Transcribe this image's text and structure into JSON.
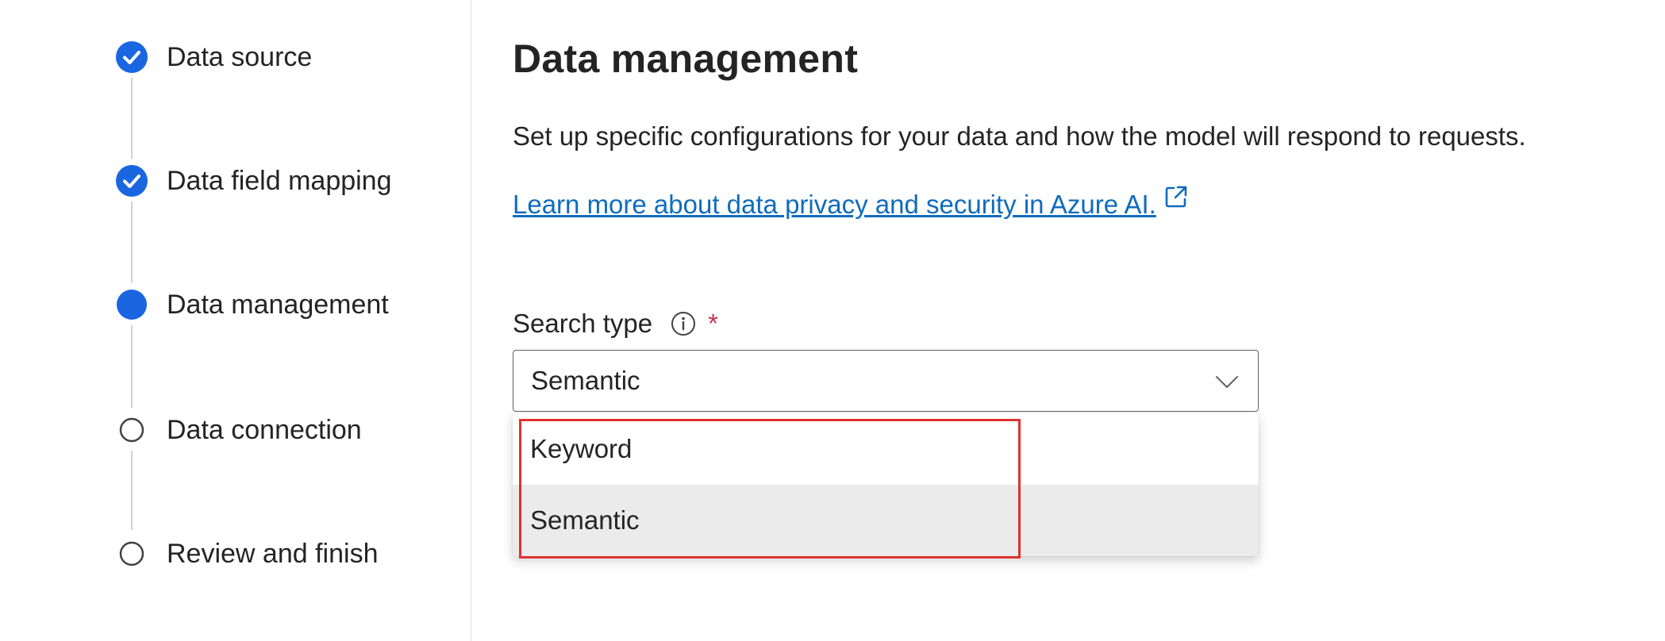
{
  "stepper": {
    "steps": [
      {
        "label": "Data source",
        "status": "completed"
      },
      {
        "label": "Data field mapping",
        "status": "completed"
      },
      {
        "label": "Data management",
        "status": "current"
      },
      {
        "label": "Data connection",
        "status": "pending"
      },
      {
        "label": "Review and finish",
        "status": "pending"
      }
    ]
  },
  "main": {
    "title": "Data management",
    "description": "Set up specific configurations for your data and how the model will respond to requests.",
    "learn_link": "Learn more about data privacy and security in Azure AI.",
    "search_type": {
      "label": "Search type",
      "required_marker": "*",
      "selected_value": "Semantic",
      "options": [
        {
          "label": "Keyword",
          "selected": false
        },
        {
          "label": "Semantic",
          "selected": true
        }
      ]
    }
  },
  "colors": {
    "accent": "#0f6cbd",
    "step_complete": "#1a66e0",
    "required": "#c4314b",
    "highlight": "#e0312f",
    "selected_option_bg": "#ebebeb"
  },
  "icons": {
    "completed": "checkmark-circle-icon",
    "current": "filled-circle-icon",
    "pending": "empty-circle-icon",
    "info": "info-icon",
    "external_link": "open-external-icon",
    "dropdown": "chevron-down-icon"
  }
}
